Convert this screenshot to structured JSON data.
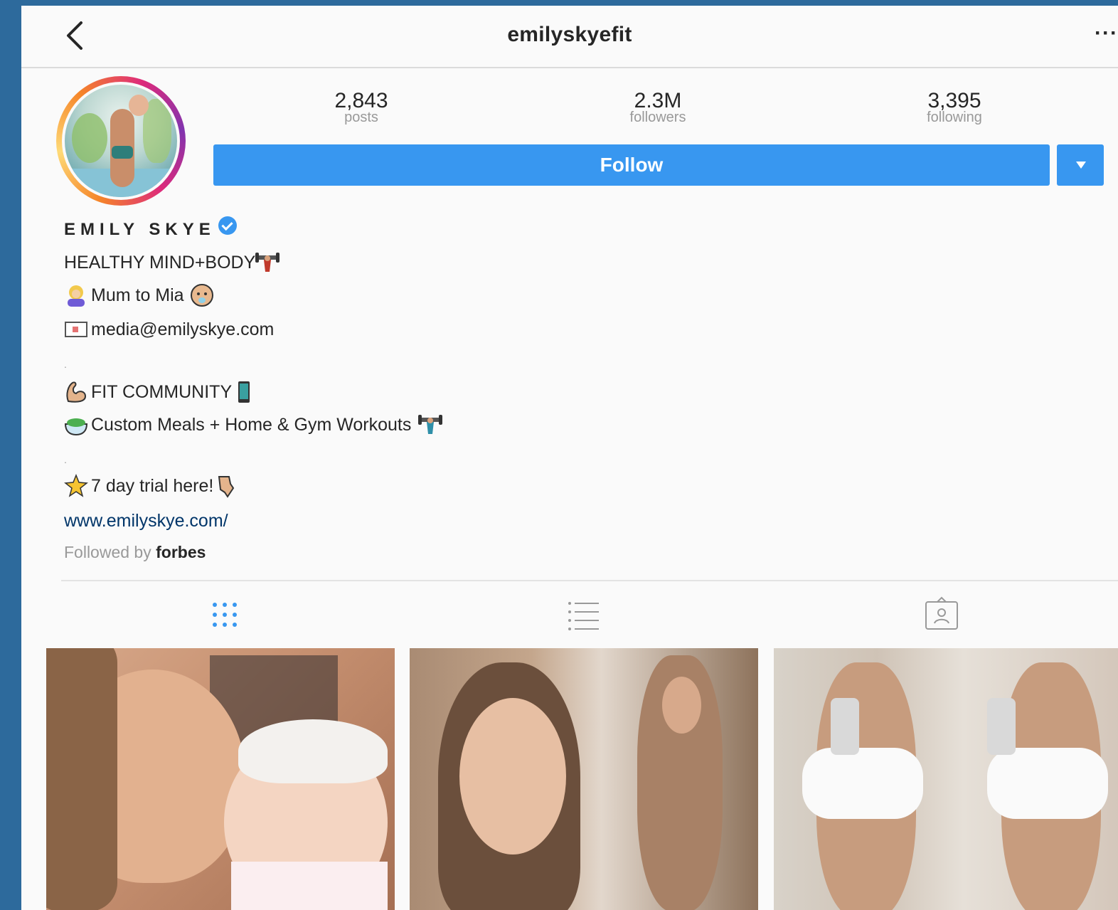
{
  "header": {
    "username": "emilyskyefit",
    "more_label": "···"
  },
  "stats": [
    {
      "value": "2,843",
      "label": "posts"
    },
    {
      "value": "2.3M",
      "label": "followers"
    },
    {
      "value": "3,395",
      "label": "following"
    }
  ],
  "actions": {
    "follow_label": "Follow"
  },
  "bio": {
    "name": "EMILY SKYE",
    "lines": [
      "HEALTHY MIND+BODY",
      "Mum to Mia",
      "media@emilyskye.com",
      ".",
      "FIT COMMUNITY",
      "Custom Meals + Home & Gym Workouts",
      ".",
      "7 day trial here!"
    ],
    "website": "www.emilyskye.com/",
    "followed_by_prefix": "Followed by",
    "followed_by_user": "forbes"
  },
  "tabs": [
    "grid-view",
    "list-view",
    "tagged"
  ],
  "colors": {
    "accent": "#3897f0",
    "link": "#003569",
    "background": "#fafafa",
    "frame": "#2d6a9c"
  }
}
